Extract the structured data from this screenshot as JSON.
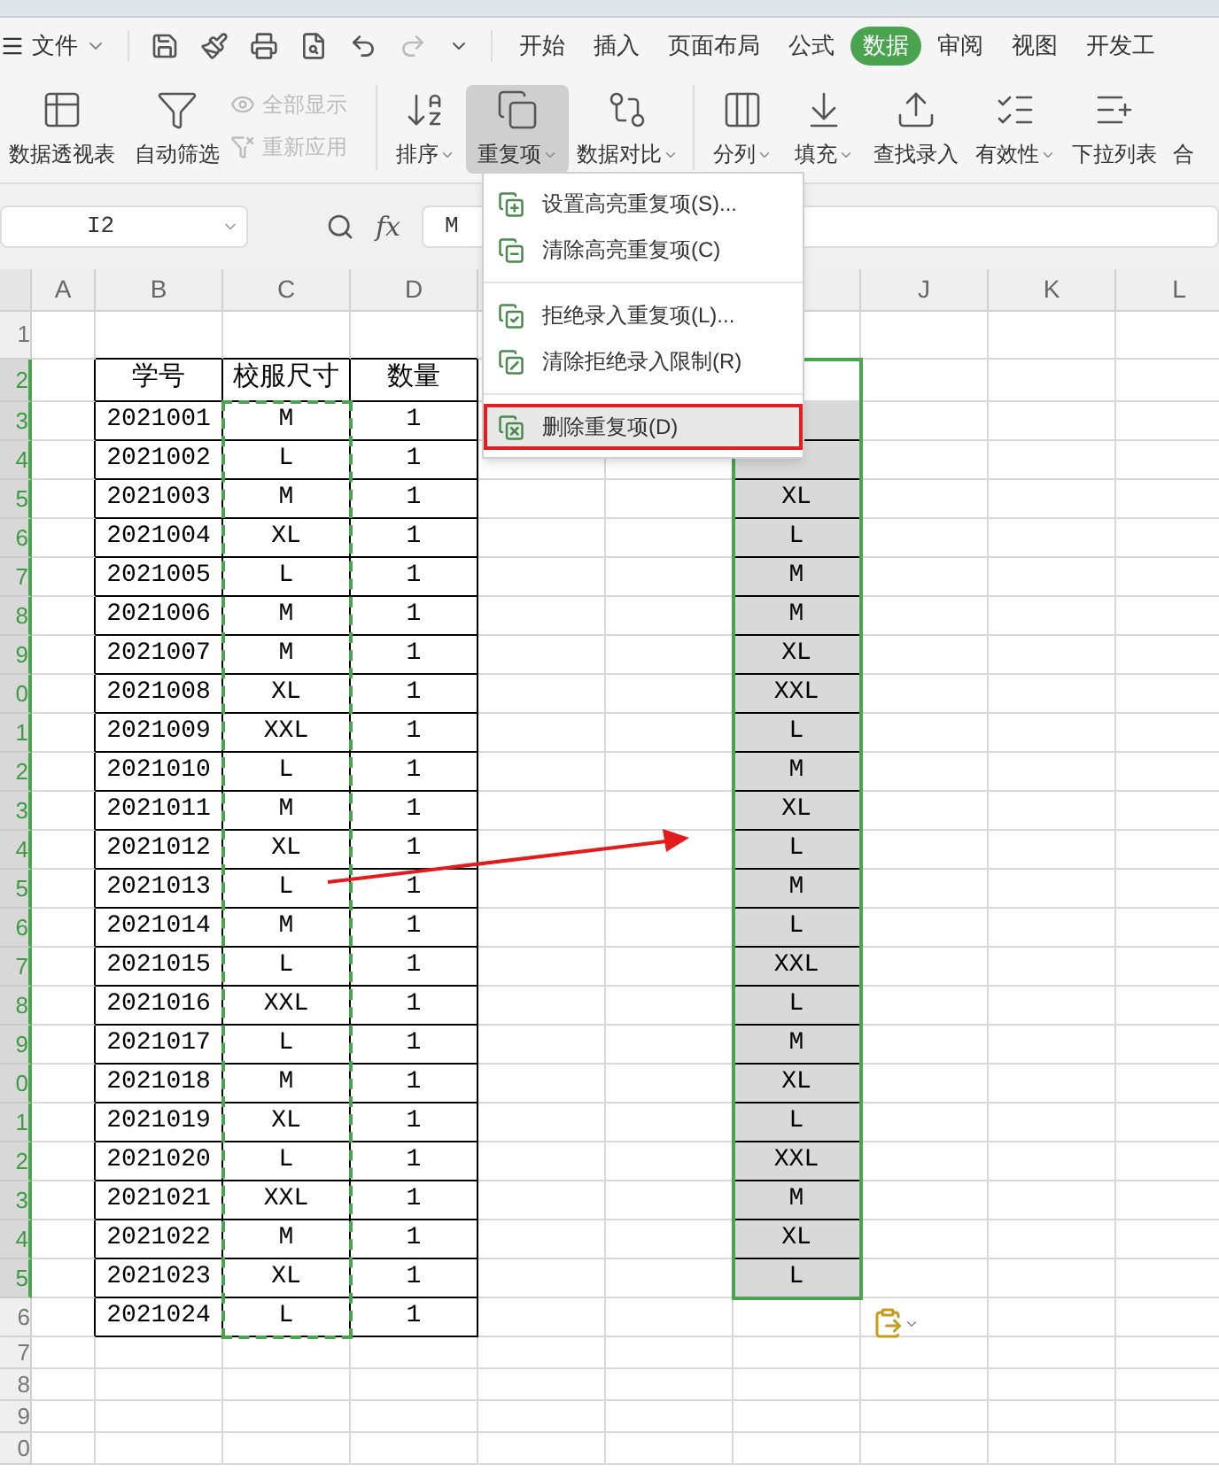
{
  "menu_bar": {
    "file_menu": "文件",
    "tabs": [
      {
        "label": "开始",
        "selected": false
      },
      {
        "label": "插入",
        "selected": false
      },
      {
        "label": "页面布局",
        "selected": false
      },
      {
        "label": "公式",
        "selected": false
      },
      {
        "label": "数据",
        "selected": true
      },
      {
        "label": "审阅",
        "selected": false
      },
      {
        "label": "视图",
        "selected": false
      },
      {
        "label": "开发工",
        "selected": false
      }
    ]
  },
  "ribbon": [
    {
      "kind": "large",
      "label": "数据透视表",
      "dropdown": false,
      "active": false
    },
    {
      "kind": "large",
      "label": "自动筛选",
      "dropdown": false,
      "active": false
    },
    {
      "kind": "stack",
      "items": [
        {
          "label": "全部显示",
          "disabled": true
        },
        {
          "label": "重新应用",
          "disabled": true
        }
      ]
    },
    {
      "kind": "large",
      "label": "排序",
      "dropdown": true,
      "active": false
    },
    {
      "kind": "large",
      "label": "重复项",
      "dropdown": true,
      "active": true
    },
    {
      "kind": "large",
      "label": "数据对比",
      "dropdown": true,
      "active": false
    },
    {
      "kind": "large",
      "label": "分列",
      "dropdown": true,
      "active": false
    },
    {
      "kind": "large",
      "label": "填充",
      "dropdown": true,
      "active": false
    },
    {
      "kind": "large",
      "label": "查找录入",
      "dropdown": false,
      "active": false
    },
    {
      "kind": "large",
      "label": "有效性",
      "dropdown": true,
      "active": false
    },
    {
      "kind": "large",
      "label": "下拉列表",
      "dropdown": false,
      "active": false
    },
    {
      "kind": "cut",
      "label": "合"
    }
  ],
  "formula_bar": {
    "cell_ref": "I2",
    "fx": "fx",
    "value": "M"
  },
  "column_headers_left": [
    "A",
    "B",
    "C",
    "D"
  ],
  "column_headers_right": [
    "J",
    "K",
    "L"
  ],
  "row_headers": [
    {
      "label": "1",
      "selected": false
    },
    {
      "label": "2",
      "selected": true
    },
    {
      "label": "3",
      "selected": true
    },
    {
      "label": "4",
      "selected": true
    },
    {
      "label": "5",
      "selected": true
    },
    {
      "label": "6",
      "selected": true
    },
    {
      "label": "7",
      "selected": true
    },
    {
      "label": "8",
      "selected": true
    },
    {
      "label": "9",
      "selected": true
    },
    {
      "label": "0",
      "selected": true
    },
    {
      "label": "1",
      "selected": true
    },
    {
      "label": "2",
      "selected": true
    },
    {
      "label": "3",
      "selected": true
    },
    {
      "label": "4",
      "selected": true
    },
    {
      "label": "5",
      "selected": true
    },
    {
      "label": "6",
      "selected": true
    },
    {
      "label": "7",
      "selected": true
    },
    {
      "label": "8",
      "selected": true
    },
    {
      "label": "9",
      "selected": true
    },
    {
      "label": "0",
      "selected": true
    },
    {
      "label": "1",
      "selected": true
    },
    {
      "label": "2",
      "selected": true
    },
    {
      "label": "3",
      "selected": true
    },
    {
      "label": "4",
      "selected": true
    },
    {
      "label": "5",
      "selected": true
    },
    {
      "label": "6",
      "selected": false
    },
    {
      "label": "7",
      "selected": false
    },
    {
      "label": "8",
      "selected": false
    },
    {
      "label": "9",
      "selected": false
    },
    {
      "label": "0",
      "selected": false
    }
  ],
  "table": {
    "columns": [
      "学号",
      "校服尺寸",
      "数量"
    ],
    "rows": [
      [
        "2021001",
        "M",
        "1"
      ],
      [
        "2021002",
        "L",
        "1"
      ],
      [
        "2021003",
        "M",
        "1"
      ],
      [
        "2021004",
        "XL",
        "1"
      ],
      [
        "2021005",
        "L",
        "1"
      ],
      [
        "2021006",
        "M",
        "1"
      ],
      [
        "2021007",
        "M",
        "1"
      ],
      [
        "2021008",
        "XL",
        "1"
      ],
      [
        "2021009",
        "XXL",
        "1"
      ],
      [
        "2021010",
        "L",
        "1"
      ],
      [
        "2021011",
        "M",
        "1"
      ],
      [
        "2021012",
        "XL",
        "1"
      ],
      [
        "2021013",
        "L",
        "1"
      ],
      [
        "2021014",
        "M",
        "1"
      ],
      [
        "2021015",
        "L",
        "1"
      ],
      [
        "2021016",
        "XXL",
        "1"
      ],
      [
        "2021017",
        "L",
        "1"
      ],
      [
        "2021018",
        "M",
        "1"
      ],
      [
        "2021019",
        "XL",
        "1"
      ],
      [
        "2021020",
        "L",
        "1"
      ],
      [
        "2021021",
        "XXL",
        "1"
      ],
      [
        "2021022",
        "M",
        "1"
      ],
      [
        "2021023",
        "XL",
        "1"
      ],
      [
        "2021024",
        "L",
        "1"
      ]
    ]
  },
  "column_i_values": [
    "XL",
    "L",
    "M",
    "M",
    "XL",
    "XXL",
    "L",
    "M",
    "XL",
    "L",
    "M",
    "L",
    "XXL",
    "L",
    "M",
    "XL",
    "L",
    "XXL",
    "M",
    "XL",
    "L"
  ],
  "duplicates_menu": [
    {
      "kind": "item",
      "label": "设置高亮重复项(S)...",
      "selected": false
    },
    {
      "kind": "item",
      "label": "清除高亮重复项(C)",
      "selected": false
    },
    {
      "kind": "divider"
    },
    {
      "kind": "item",
      "label": "拒绝录入重复项(L)...",
      "selected": false
    },
    {
      "kind": "item",
      "label": "清除拒绝录入限制(R)",
      "selected": false
    },
    {
      "kind": "divider"
    },
    {
      "kind": "item",
      "label": "删除重复项(D)",
      "selected": true
    }
  ]
}
